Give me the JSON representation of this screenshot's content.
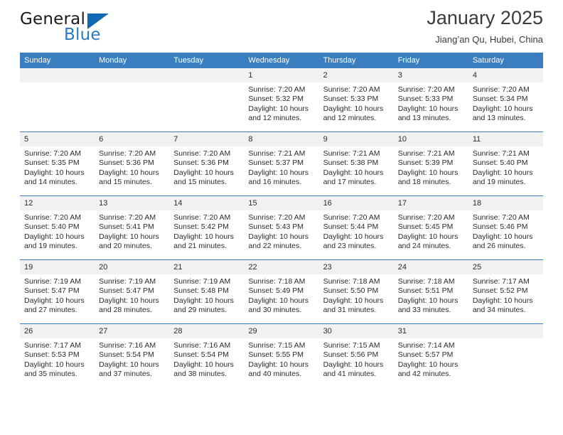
{
  "brand": {
    "word1": "General",
    "word2": "Blue",
    "logo_icon": "triangle-logo-icon",
    "accent_color": "#2a7ac0"
  },
  "header": {
    "title": "January 2025",
    "subtitle": "Jiang’an Qu, Hubei, China"
  },
  "theme": {
    "header_row_color": "#3a7ebf",
    "daynum_band_color": "#f1f1f1",
    "text_color": "#2b2b2b"
  },
  "calendar": {
    "weekday_headers": [
      "Sunday",
      "Monday",
      "Tuesday",
      "Wednesday",
      "Thursday",
      "Friday",
      "Saturday"
    ],
    "weeks": [
      [
        {
          "day": "",
          "empty": true
        },
        {
          "day": "",
          "empty": true
        },
        {
          "day": "",
          "empty": true
        },
        {
          "day": "1",
          "sunrise": "Sunrise: 7:20 AM",
          "sunset": "Sunset: 5:32 PM",
          "daylight1": "Daylight: 10 hours",
          "daylight2": "and 12 minutes."
        },
        {
          "day": "2",
          "sunrise": "Sunrise: 7:20 AM",
          "sunset": "Sunset: 5:33 PM",
          "daylight1": "Daylight: 10 hours",
          "daylight2": "and 12 minutes."
        },
        {
          "day": "3",
          "sunrise": "Sunrise: 7:20 AM",
          "sunset": "Sunset: 5:33 PM",
          "daylight1": "Daylight: 10 hours",
          "daylight2": "and 13 minutes."
        },
        {
          "day": "4",
          "sunrise": "Sunrise: 7:20 AM",
          "sunset": "Sunset: 5:34 PM",
          "daylight1": "Daylight: 10 hours",
          "daylight2": "and 13 minutes."
        }
      ],
      [
        {
          "day": "5",
          "sunrise": "Sunrise: 7:20 AM",
          "sunset": "Sunset: 5:35 PM",
          "daylight1": "Daylight: 10 hours",
          "daylight2": "and 14 minutes."
        },
        {
          "day": "6",
          "sunrise": "Sunrise: 7:20 AM",
          "sunset": "Sunset: 5:36 PM",
          "daylight1": "Daylight: 10 hours",
          "daylight2": "and 15 minutes."
        },
        {
          "day": "7",
          "sunrise": "Sunrise: 7:20 AM",
          "sunset": "Sunset: 5:36 PM",
          "daylight1": "Daylight: 10 hours",
          "daylight2": "and 15 minutes."
        },
        {
          "day": "8",
          "sunrise": "Sunrise: 7:21 AM",
          "sunset": "Sunset: 5:37 PM",
          "daylight1": "Daylight: 10 hours",
          "daylight2": "and 16 minutes."
        },
        {
          "day": "9",
          "sunrise": "Sunrise: 7:21 AM",
          "sunset": "Sunset: 5:38 PM",
          "daylight1": "Daylight: 10 hours",
          "daylight2": "and 17 minutes."
        },
        {
          "day": "10",
          "sunrise": "Sunrise: 7:21 AM",
          "sunset": "Sunset: 5:39 PM",
          "daylight1": "Daylight: 10 hours",
          "daylight2": "and 18 minutes."
        },
        {
          "day": "11",
          "sunrise": "Sunrise: 7:21 AM",
          "sunset": "Sunset: 5:40 PM",
          "daylight1": "Daylight: 10 hours",
          "daylight2": "and 19 minutes."
        }
      ],
      [
        {
          "day": "12",
          "sunrise": "Sunrise: 7:20 AM",
          "sunset": "Sunset: 5:40 PM",
          "daylight1": "Daylight: 10 hours",
          "daylight2": "and 19 minutes."
        },
        {
          "day": "13",
          "sunrise": "Sunrise: 7:20 AM",
          "sunset": "Sunset: 5:41 PM",
          "daylight1": "Daylight: 10 hours",
          "daylight2": "and 20 minutes."
        },
        {
          "day": "14",
          "sunrise": "Sunrise: 7:20 AM",
          "sunset": "Sunset: 5:42 PM",
          "daylight1": "Daylight: 10 hours",
          "daylight2": "and 21 minutes."
        },
        {
          "day": "15",
          "sunrise": "Sunrise: 7:20 AM",
          "sunset": "Sunset: 5:43 PM",
          "daylight1": "Daylight: 10 hours",
          "daylight2": "and 22 minutes."
        },
        {
          "day": "16",
          "sunrise": "Sunrise: 7:20 AM",
          "sunset": "Sunset: 5:44 PM",
          "daylight1": "Daylight: 10 hours",
          "daylight2": "and 23 minutes."
        },
        {
          "day": "17",
          "sunrise": "Sunrise: 7:20 AM",
          "sunset": "Sunset: 5:45 PM",
          "daylight1": "Daylight: 10 hours",
          "daylight2": "and 24 minutes."
        },
        {
          "day": "18",
          "sunrise": "Sunrise: 7:20 AM",
          "sunset": "Sunset: 5:46 PM",
          "daylight1": "Daylight: 10 hours",
          "daylight2": "and 26 minutes."
        }
      ],
      [
        {
          "day": "19",
          "sunrise": "Sunrise: 7:19 AM",
          "sunset": "Sunset: 5:47 PM",
          "daylight1": "Daylight: 10 hours",
          "daylight2": "and 27 minutes."
        },
        {
          "day": "20",
          "sunrise": "Sunrise: 7:19 AM",
          "sunset": "Sunset: 5:47 PM",
          "daylight1": "Daylight: 10 hours",
          "daylight2": "and 28 minutes."
        },
        {
          "day": "21",
          "sunrise": "Sunrise: 7:19 AM",
          "sunset": "Sunset: 5:48 PM",
          "daylight1": "Daylight: 10 hours",
          "daylight2": "and 29 minutes."
        },
        {
          "day": "22",
          "sunrise": "Sunrise: 7:18 AM",
          "sunset": "Sunset: 5:49 PM",
          "daylight1": "Daylight: 10 hours",
          "daylight2": "and 30 minutes."
        },
        {
          "day": "23",
          "sunrise": "Sunrise: 7:18 AM",
          "sunset": "Sunset: 5:50 PM",
          "daylight1": "Daylight: 10 hours",
          "daylight2": "and 31 minutes."
        },
        {
          "day": "24",
          "sunrise": "Sunrise: 7:18 AM",
          "sunset": "Sunset: 5:51 PM",
          "daylight1": "Daylight: 10 hours",
          "daylight2": "and 33 minutes."
        },
        {
          "day": "25",
          "sunrise": "Sunrise: 7:17 AM",
          "sunset": "Sunset: 5:52 PM",
          "daylight1": "Daylight: 10 hours",
          "daylight2": "and 34 minutes."
        }
      ],
      [
        {
          "day": "26",
          "sunrise": "Sunrise: 7:17 AM",
          "sunset": "Sunset: 5:53 PM",
          "daylight1": "Daylight: 10 hours",
          "daylight2": "and 35 minutes."
        },
        {
          "day": "27",
          "sunrise": "Sunrise: 7:16 AM",
          "sunset": "Sunset: 5:54 PM",
          "daylight1": "Daylight: 10 hours",
          "daylight2": "and 37 minutes."
        },
        {
          "day": "28",
          "sunrise": "Sunrise: 7:16 AM",
          "sunset": "Sunset: 5:54 PM",
          "daylight1": "Daylight: 10 hours",
          "daylight2": "and 38 minutes."
        },
        {
          "day": "29",
          "sunrise": "Sunrise: 7:15 AM",
          "sunset": "Sunset: 5:55 PM",
          "daylight1": "Daylight: 10 hours",
          "daylight2": "and 40 minutes."
        },
        {
          "day": "30",
          "sunrise": "Sunrise: 7:15 AM",
          "sunset": "Sunset: 5:56 PM",
          "daylight1": "Daylight: 10 hours",
          "daylight2": "and 41 minutes."
        },
        {
          "day": "31",
          "sunrise": "Sunrise: 7:14 AM",
          "sunset": "Sunset: 5:57 PM",
          "daylight1": "Daylight: 10 hours",
          "daylight2": "and 42 minutes."
        },
        {
          "day": "",
          "empty": true
        }
      ]
    ]
  }
}
